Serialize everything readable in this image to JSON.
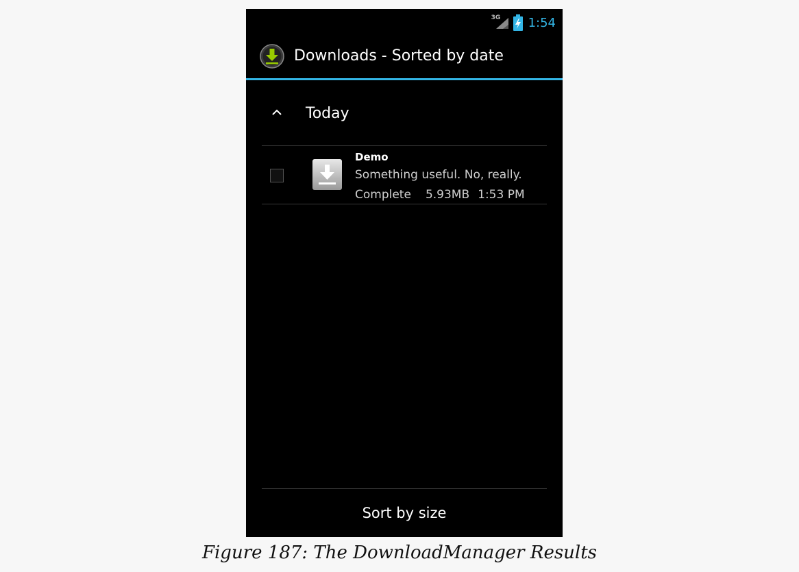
{
  "status_bar": {
    "network_type": "3G",
    "time": "1:54",
    "signal_icon": "cell-signal-icon",
    "battery_icon": "battery-charging-icon"
  },
  "action_bar": {
    "icon": "download-app-icon",
    "title": "Downloads - Sorted by date"
  },
  "group": {
    "icon": "chevron-up-icon",
    "title": "Today"
  },
  "downloads": [
    {
      "title": "Demo",
      "description": "Something useful. No, really.",
      "status": "Complete",
      "size": "5.93MB",
      "time": "1:53 PM",
      "icon": "download-file-icon",
      "checked": false
    }
  ],
  "bottom_bar": {
    "sort_button_label": "Sort by size"
  },
  "caption": "Figure 187: The DownloadManager Results",
  "colors": {
    "accent": "#33b5e5",
    "background": "#000000",
    "page": "#f7f7f7"
  }
}
